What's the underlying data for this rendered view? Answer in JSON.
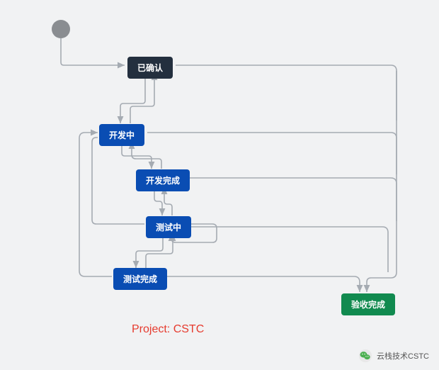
{
  "nodes": {
    "confirmed": {
      "label": "已确认",
      "type": "dark"
    },
    "in_dev": {
      "label": "开发中",
      "type": "blue"
    },
    "dev_done": {
      "label": "开发完成",
      "type": "blue"
    },
    "in_test": {
      "label": "测试中",
      "type": "blue"
    },
    "test_done": {
      "label": "测试完成",
      "type": "blue"
    },
    "accept_done": {
      "label": "验收完成",
      "type": "green"
    }
  },
  "start": {
    "kind": "initial-state"
  },
  "caption": "Project: CSTC",
  "footer": {
    "brand": "云栈技术CSTC",
    "icon": "wechat-icon"
  },
  "edges_note": "Arrows connect: start→已确认; 已确认↔开发中; 开发中↔开发完成; 开发完成↔测试中; 测试中↔测试完成; 测试中→开发中 (loop); 测试完成→开发中 (loop); 已确认/开发中/开发完成/测试中/测试完成→验收完成"
}
